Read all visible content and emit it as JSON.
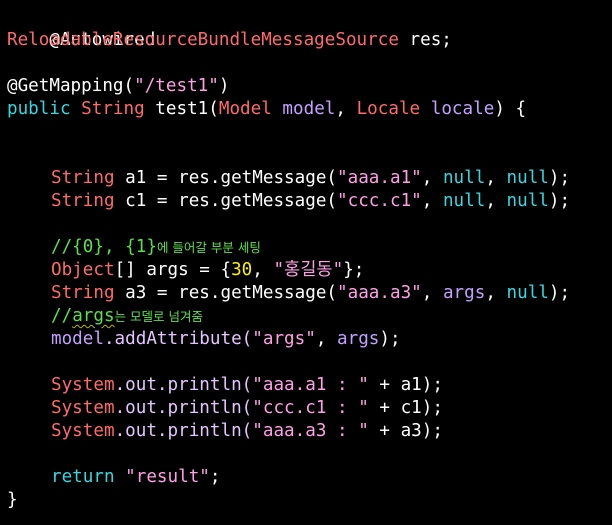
{
  "colors": {
    "background": "#000000",
    "default_text": "#ffffff",
    "class_name": "#ff6a6a",
    "keyword": "#37d7e0",
    "string": "#ff9fe6",
    "method": "#e4c4ff",
    "variable": "#c3a0ff",
    "number": "#fff000",
    "comment": "#59e04a"
  },
  "code": {
    "l1": {
      "annotation": "@Autowired"
    },
    "l2": {
      "type": "ReloadableResourceBundleMessageSource",
      "rest": " res;"
    },
    "l4": {
      "annotation": "@GetMapping(",
      "arg": "\"/test1\"",
      "close": ")"
    },
    "l5": {
      "kw": "public",
      "type": "String",
      "name": " test1(",
      "p1type": "Model",
      "p1name": " model",
      "comma": ", ",
      "p2type": "Locale",
      "p2name": " locale",
      "close": ") {"
    },
    "l8": {
      "type": "String",
      "var": " a1 = res.getMessage(",
      "arg1": "\"aaa.a1\"",
      "sep": ", ",
      "null1": "null",
      "sep2": ", ",
      "null2": "null",
      "end": ");"
    },
    "l9": {
      "type": "String",
      "var": " c1 = res.getMessage(",
      "arg1": "\"ccc.c1\"",
      "sep": ", ",
      "null1": "null",
      "sep2": ", ",
      "null2": "null",
      "end": ");"
    },
    "l11": {
      "comment": "//{0}, {1}",
      "comment_kr": "에 들어갈 부분 세팅"
    },
    "l12": {
      "type": "Object",
      "rest": "[] args = {",
      "num": "30",
      "sep": ", ",
      "str": "\"홍길동\"",
      "end": "};"
    },
    "l13": {
      "type": "String",
      "var": " a3 = res.getMessage(",
      "arg1": "\"aaa.a3\"",
      "sep": ", ",
      "args": "args",
      "sep2": ", ",
      "null2": "null",
      "end": ");"
    },
    "l14": {
      "comment": "//",
      "squiggle": "args",
      "comment_kr": "는 모델로 넘겨줌"
    },
    "l15": {
      "obj": "model",
      "dot": ".addAttribute(",
      "str": "\"args\"",
      "sep": ", ",
      "args": "args",
      "end": ");"
    },
    "l17": {
      "cls": "System",
      "dot": ".out.println(",
      "str": "\"aaa.a1 : \"",
      "plus": " + a1);"
    },
    "l18": {
      "cls": "System",
      "dot": ".out.println(",
      "str": "\"ccc.c1 : \"",
      "plus": " + c1);"
    },
    "l19": {
      "cls": "System",
      "dot": ".out.println(",
      "str": "\"aaa.a3 : \"",
      "plus": " + a3);"
    },
    "l21": {
      "kw": "return",
      "sp": " ",
      "str": "\"result\"",
      "end": ";"
    },
    "l22": {
      "close": "}"
    }
  }
}
